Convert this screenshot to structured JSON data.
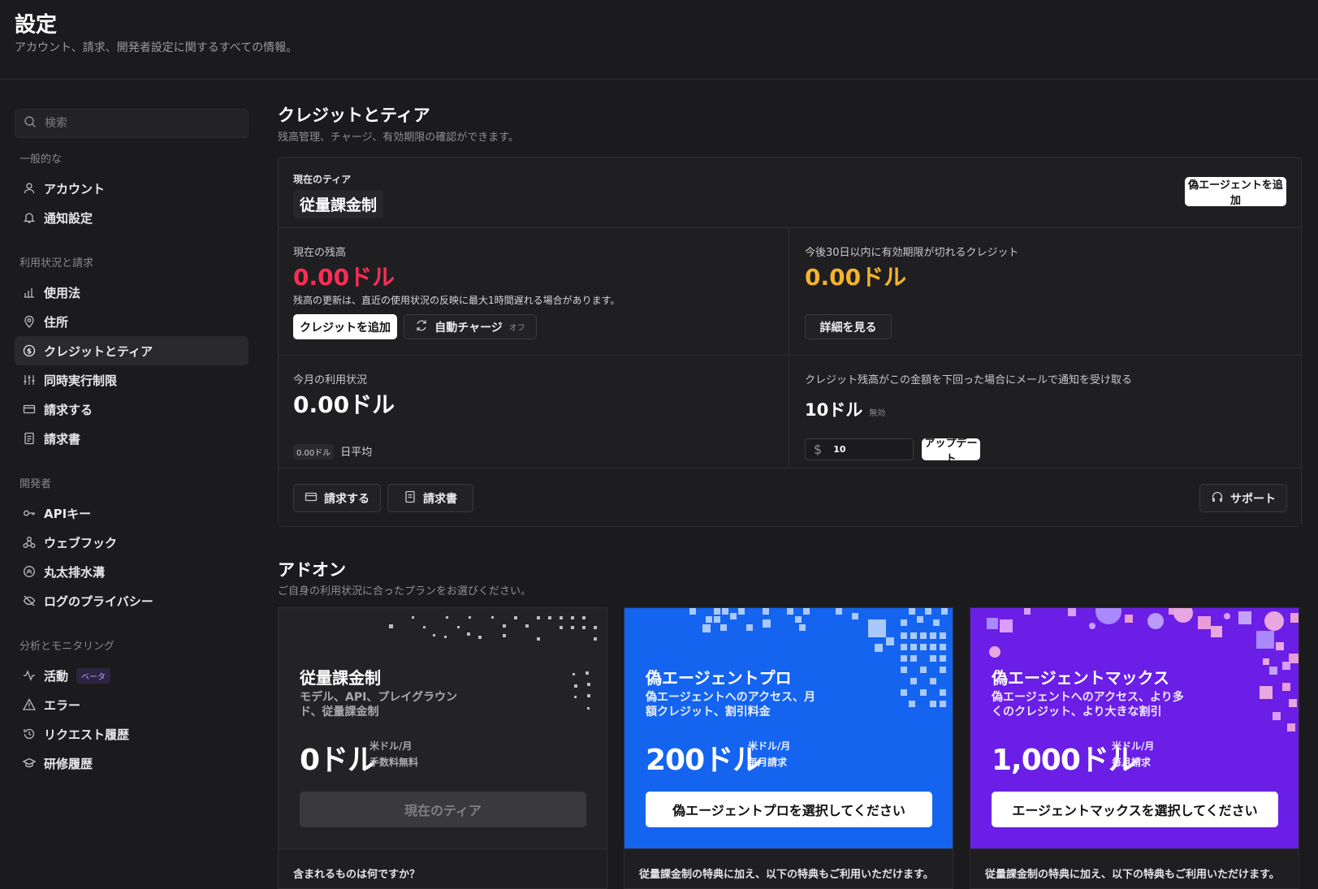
{
  "header": {
    "title": "設定",
    "subtitle": "アカウント、請求、開発者設定に関するすべての情報。"
  },
  "sidebar": {
    "search_placeholder": "検索",
    "groups": [
      {
        "title": "一般的な",
        "items": [
          {
            "label": "アカウント",
            "icon": "user-icon"
          },
          {
            "label": "通知設定",
            "icon": "bell-icon"
          }
        ]
      },
      {
        "title": "利用状況と請求",
        "items": [
          {
            "label": "使用法",
            "icon": "bar-chart-icon"
          },
          {
            "label": "住所",
            "icon": "map-pin-icon"
          },
          {
            "label": "クレジットとティア",
            "icon": "dollar-circle-icon",
            "active": true
          },
          {
            "label": "同時実行制限",
            "icon": "sliders-icon"
          },
          {
            "label": "請求する",
            "icon": "credit-card-icon"
          },
          {
            "label": "請求書",
            "icon": "receipt-icon"
          }
        ]
      },
      {
        "title": "開発者",
        "items": [
          {
            "label": "APIキー",
            "icon": "key-icon"
          },
          {
            "label": "ウェブフック",
            "icon": "webhook-icon"
          },
          {
            "label": "丸太排水溝",
            "icon": "drain-icon"
          },
          {
            "label": "ログのプライバシー",
            "icon": "eye-off-icon"
          }
        ]
      },
      {
        "title": "分析とモニタリング",
        "items": [
          {
            "label": "活動",
            "icon": "activity-icon",
            "badge": "ベータ"
          },
          {
            "label": "エラー",
            "icon": "warning-icon"
          },
          {
            "label": "リクエスト履歴",
            "icon": "history-icon"
          },
          {
            "label": "研修履歴",
            "icon": "graduation-cap-icon"
          }
        ]
      }
    ]
  },
  "credits": {
    "title": "クレジットとティア",
    "subtitle": "残高管理、チャージ、有効期限の確認ができます。",
    "current_tier_label": "現在のティア",
    "current_tier_value": "従量課金制",
    "add_agent_button": "偽エージェントを追加",
    "balance_label": "現在の残高",
    "balance_value": "0.00ドル",
    "balance_note": "残高の更新は、直近の使用状況の反映に最大1時間遅れる場合があります。",
    "add_credits_button": "クレジットを追加",
    "auto_charge_button": "自動チャージ",
    "auto_charge_state": "オフ",
    "expiring_label": "今後30日以内に有効期限が切れるクレジット",
    "expiring_value": "0.00ドル",
    "details_button": "詳細を見る",
    "monthly_label": "今月の利用状況",
    "monthly_value": "0.00ドル",
    "daily_avg_value": "0.00ドル",
    "daily_avg_label": "日平均",
    "threshold_label": "クレジット残高がこの金額を下回った場合にメールで通知を受け取る",
    "threshold_value": "10ドル",
    "threshold_state": "無効",
    "threshold_input_value": "10",
    "update_button": "アップデート",
    "billing_button": "請求する",
    "invoice_button": "請求書",
    "support_button": "サポート"
  },
  "addons": {
    "title": "アドオン",
    "subtitle": "ご自身の利用状況に合ったプランをお選びください。",
    "plans": [
      {
        "name": "従量課金制",
        "desc": "モデル、API、プレイグラウンド、従量課金制",
        "price": "0ドル",
        "price_unit": "米ドル/月",
        "price_note": "手数料無料",
        "button": "現在のティア",
        "footer": "含まれるものは何ですか？",
        "bg": "#232326"
      },
      {
        "name": "偽エージェントプロ",
        "desc": "偽エージェントへのアクセス、月額クレジット、割引料金",
        "price": "200ドル",
        "price_unit": "米ドル/月",
        "price_note": "毎月請求",
        "button": "偽エージェントプロを選択してください",
        "footer": "従量課金制の特典に加え、以下の特典もご利用いただけます。",
        "bg": "#1464f0"
      },
      {
        "name": "偽エージェントマックス",
        "desc": "偽エージェントへのアクセス、より多くのクレジット、より大きな割引",
        "price": "1,000ドル",
        "price_unit": "米ドル/月",
        "price_note": "毎月請求",
        "button": "エージェントマックスを選択してください",
        "footer": "従量課金制の特典に加え、以下の特典もご利用いただけます。",
        "bg": "#6a1ee6"
      }
    ]
  },
  "colors": {
    "balance_red": "#ff2d55",
    "expiring_yellow": "#f5b32c",
    "pro_blue": "#1464f0",
    "max_purple": "#6a1ee6"
  }
}
